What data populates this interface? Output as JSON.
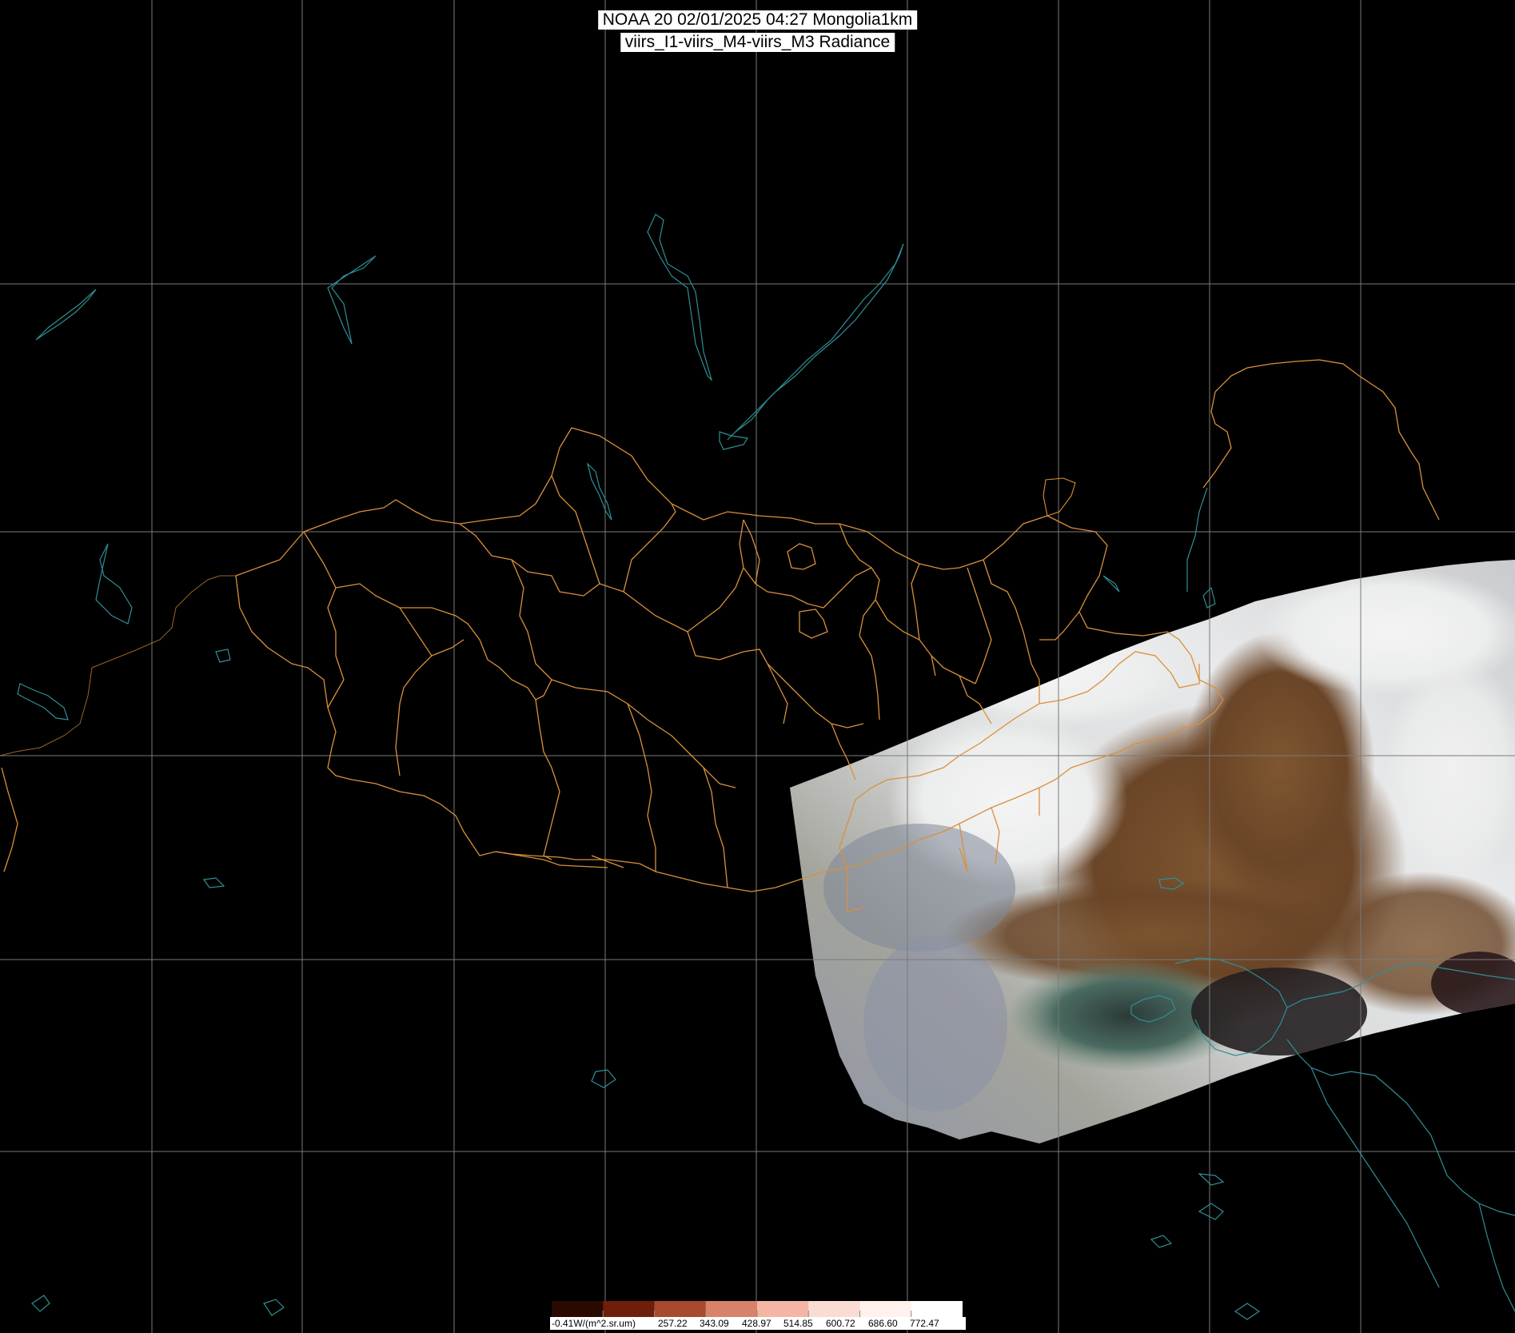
{
  "title": {
    "line1": "NOAA 20 02/01/2025 04:27 Mongolia1km",
    "line2": "viirs_I1-viirs_M4-viirs_M3 Radiance"
  },
  "colorbar": {
    "unit_label": "-0.41W/(m^2.sr.um)",
    "ticks": [
      "257.22",
      "343.09",
      "428.97",
      "514.85",
      "600.72",
      "686.60",
      "772.47"
    ],
    "colors": [
      "#2a0a00",
      "#6e1e0a",
      "#a84a2c",
      "#d8826a",
      "#f5b5a4",
      "#fbdcd3",
      "#fff1ec",
      "#ffffff"
    ]
  },
  "colors": {
    "background": "#000000",
    "grid": "#7a7a7a",
    "admin_borders": "#d9903a",
    "coastlines": "#2f8f96"
  }
}
